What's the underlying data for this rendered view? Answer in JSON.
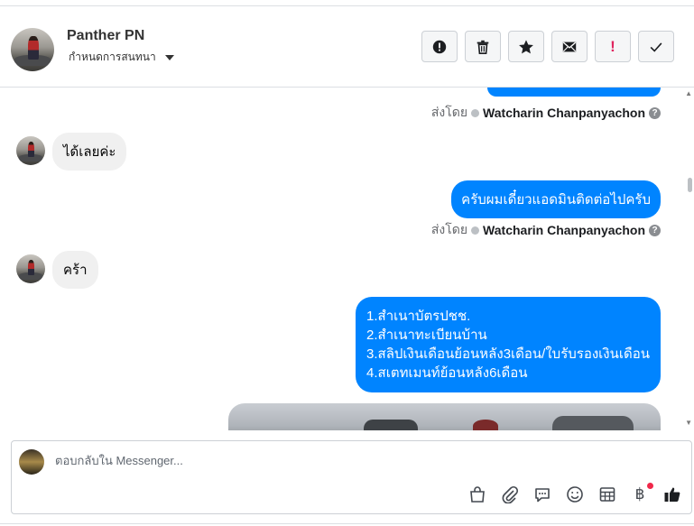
{
  "header": {
    "name": "Panther PN",
    "assign_label": "กำหนดการสนทนา",
    "tools": [
      {
        "icon": "alert-circle-icon",
        "name": "mark-spam-button"
      },
      {
        "icon": "trash-icon",
        "name": "delete-button"
      },
      {
        "icon": "star-icon",
        "name": "star-button"
      },
      {
        "icon": "envelope-icon",
        "name": "mark-unread-button"
      },
      {
        "icon": "exclamation-icon",
        "name": "follow-up-button"
      },
      {
        "icon": "checkmark-icon",
        "name": "done-button"
      }
    ]
  },
  "messages": {
    "sent_by_label": "ส่งโดย",
    "sender_name": "Watcharin Chanpanyachon",
    "items": [
      {
        "direction": "out",
        "text": ""
      },
      {
        "direction": "in",
        "text": "ได้เลยค่ะ"
      },
      {
        "direction": "out",
        "text": "ครับผมเดี๋ยวแอดมินติดต่อไปครับ"
      },
      {
        "direction": "in",
        "text": "คร้า"
      },
      {
        "direction": "out",
        "lines": [
          "1.สำเนาบัตรปชช.",
          "2.สำเนาทะเบียนบ้าน",
          "3.สลิปเงินเดือนย้อนหลัง3เดือน/ใบรับรองเงินเดือน",
          "4.สเตทเมนท์ย้อนหลัง6เดือน"
        ]
      },
      {
        "direction": "out",
        "type": "photo"
      }
    ]
  },
  "composer": {
    "placeholder": "ตอบกลับใน Messenger...",
    "icons": [
      "shopping-bag-icon",
      "paperclip-icon",
      "saved-replies-icon",
      "emoji-icon",
      "table-icon",
      "baht-icon",
      "thumbs-up-icon"
    ],
    "baht_symbol": "฿"
  },
  "colors": {
    "accent": "#0084ff",
    "incoming_bubble": "#f0f0f0",
    "follow_up": "#e0245e",
    "notification_dot": "#f0284a"
  }
}
